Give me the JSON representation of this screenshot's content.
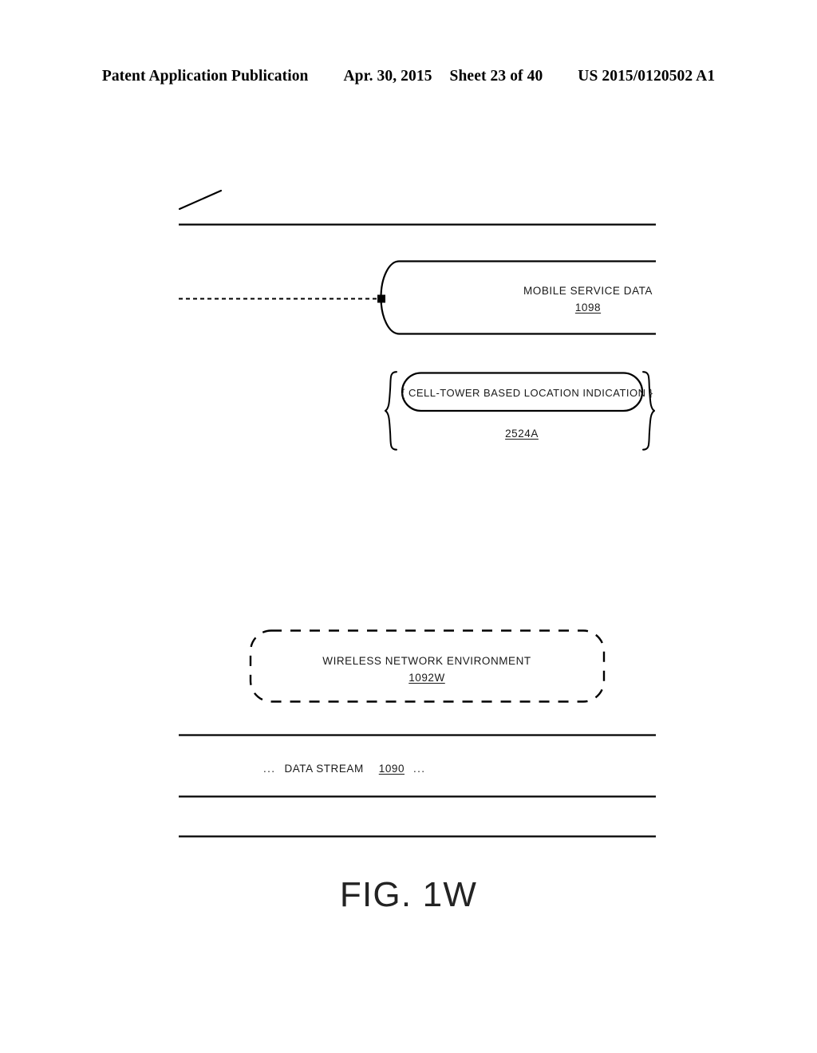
{
  "header": {
    "publication": "Patent Application Publication",
    "date": "Apr. 30, 2015",
    "sheet": "Sheet 23 of 40",
    "patent_number": "US 2015/0120502 A1"
  },
  "figure": {
    "caption": "FIG. 1W",
    "mobile_service_data": {
      "title": "MOBILE SERVICE DATA",
      "ref": "1098"
    },
    "cell_tower_indication": {
      "title": "{ CELL-TOWER BASED LOCATION INDICATION }",
      "ref": "2524A"
    },
    "wireless_network_environment": {
      "title": "WIRELESS NETWORK ENVIRONMENT",
      "ref": "1092W"
    },
    "data_stream": {
      "ellipsis_left": "...",
      "title": "DATA STREAM",
      "ref": "1090",
      "ellipsis_right": "..."
    }
  },
  "colors": {
    "ink": "#000000",
    "text": "#1a1a1a",
    "caption": "#232323",
    "background": "#ffffff"
  }
}
